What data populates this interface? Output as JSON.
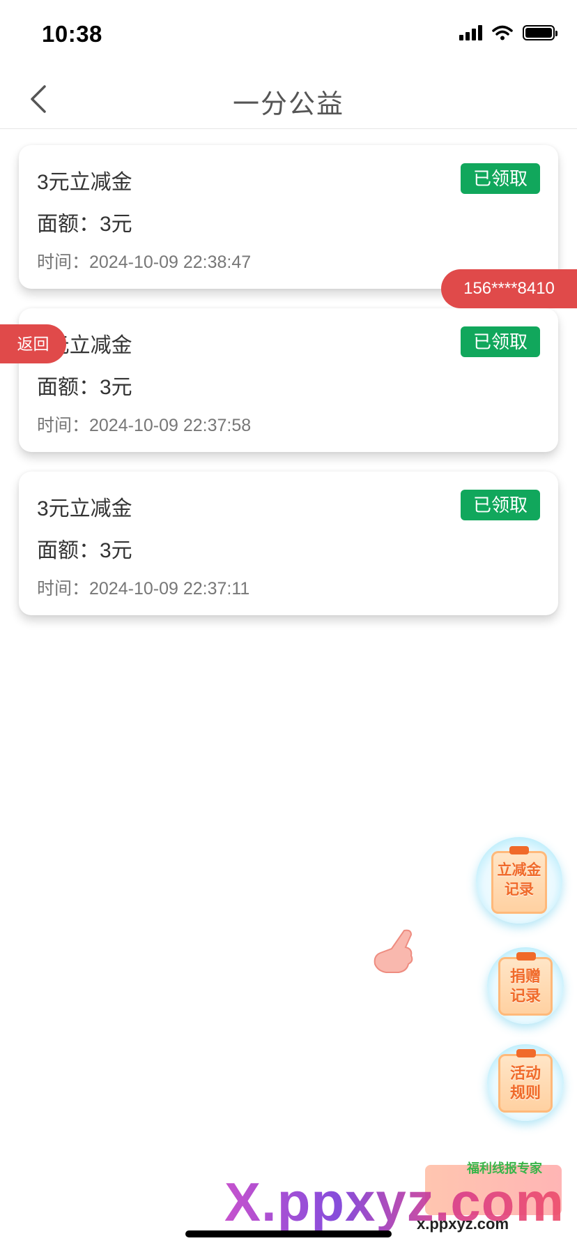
{
  "status_bar": {
    "time": "10:38"
  },
  "nav": {
    "title": "一分公益"
  },
  "cards": [
    {
      "title": "3元立减金",
      "amount": "面额：3元",
      "time": "时间：2024-10-09 22:38:47",
      "badge": "已领取"
    },
    {
      "title": "3元立减金",
      "amount": "面额：3元",
      "time": "时间：2024-10-09 22:37:58",
      "badge": "已领取"
    },
    {
      "title": "3元立减金",
      "amount": "面额：3元",
      "time": "时间：2024-10-09 22:37:11",
      "badge": "已领取"
    }
  ],
  "floating": {
    "phone": "156****8410",
    "return_label": "返回",
    "buttons": [
      {
        "line1": "立减金",
        "line2": "记录"
      },
      {
        "line1": "捐赠",
        "line2": "记录"
      },
      {
        "line1": "活动",
        "line2": "规则"
      }
    ]
  },
  "watermark": {
    "logo": "X.ppxyz.com",
    "url": "x.ppxyz.com",
    "sub": "福利线报专家"
  },
  "colors": {
    "badge_green": "#11a75c",
    "pill_red": "#e04a4a",
    "accent_orange": "#f06a2a"
  }
}
